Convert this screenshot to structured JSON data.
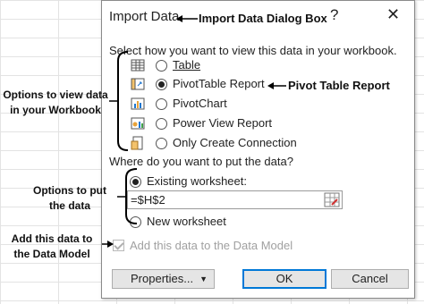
{
  "dialog": {
    "title": "Import Data",
    "help_label": "?",
    "close_label": "✕",
    "view_heading": "Select how you want to view this data in your workbook.",
    "view_options": [
      {
        "label": "Table",
        "icon": "table-icon",
        "selected": false
      },
      {
        "label": "PivotTable Report",
        "icon": "pivottable-icon",
        "selected": true
      },
      {
        "label": "PivotChart",
        "icon": "pivotchart-icon",
        "selected": false
      },
      {
        "label": "Power View Report",
        "icon": "power-view-icon",
        "selected": false
      },
      {
        "label": "Only Create Connection",
        "icon": "connection-icon",
        "selected": false
      }
    ],
    "location_heading": "Where do you want to put the data?",
    "existing_label": "Existing worksheet:",
    "existing_value": "=$H$2",
    "new_label": "New worksheet",
    "data_model_label": "Add this data to the Data Model",
    "properties_label": "Properties...",
    "ok_label": "OK",
    "cancel_label": "Cancel"
  },
  "annotations": {
    "dialog_box": "Import Data Dialog Box",
    "pivot_table_report": "Pivot Table Report",
    "view_options_line1": "Options to view data",
    "view_options_line2": "in your Workbook",
    "put_options_line1": "Options to put",
    "put_options_line2": "the  data",
    "data_model_line1": "Add this data to",
    "data_model_line2": "the Data Model"
  },
  "colors": {
    "accent": "#0078d7",
    "disabled_text": "#a0a0a0"
  }
}
